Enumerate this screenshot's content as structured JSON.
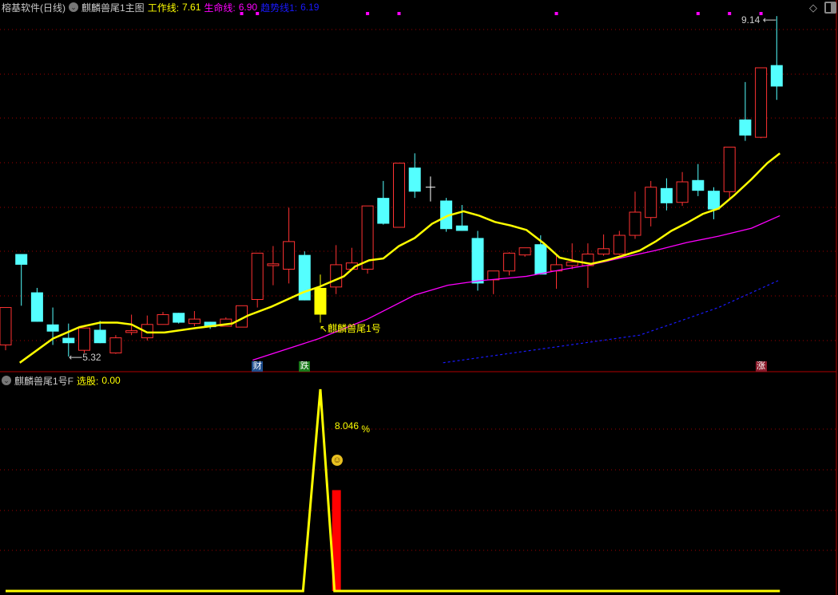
{
  "main_header": {
    "app_title": "榕基软件(日线)",
    "indicator_name": "麒麟兽尾1主图",
    "work_line_label": "工作线:",
    "work_line_value": "7.61",
    "life_line_label": "生命线:",
    "life_line_value": "6.90",
    "trend_line_label": "趋势线1:",
    "trend_line_value": "6.19"
  },
  "sub_header": {
    "indicator_name": "麒麟兽尾1号F",
    "select_label": "选股:",
    "select_value": "0.00"
  },
  "icons": {
    "collapse": "chevron-down-circle-icon",
    "diamond": "diamond-icon",
    "window": "window-toggle-icon"
  },
  "colors": {
    "up": "#ff3232",
    "down": "#54ffff",
    "signal": "#ffff00",
    "work_line": "#ffff00",
    "life_line": "#ff00ff",
    "trend_line": "#1a1aff",
    "grid": "#a00000"
  },
  "annotations": {
    "high_label": "9.14",
    "low_label": "5.32",
    "signal_label": "麒麟兽尾1号",
    "percent_value": "8.046",
    "percent_sign": "%",
    "markers": [
      {
        "text": "财",
        "index": 17,
        "bg": "#1f4f8f"
      },
      {
        "text": "跌",
        "index": 20,
        "bg": "#1a7a1a"
      },
      {
        "text": "涨",
        "index": 49,
        "bg": "#8a1a2a"
      }
    ],
    "top_dots": [
      16,
      17,
      24,
      26,
      36,
      45,
      47,
      49
    ]
  },
  "chart_data": {
    "type": "candlestick",
    "price_range": [
      5.32,
      9.14
    ],
    "signal_index": 21,
    "candles": [
      [
        5.45,
        5.87,
        5.87,
        5.39
      ],
      [
        6.47,
        6.35,
        6.47,
        5.89
      ],
      [
        6.04,
        5.71,
        6.09,
        5.71
      ],
      [
        5.68,
        5.6,
        5.87,
        5.45
      ],
      [
        5.53,
        5.47,
        5.69,
        5.32
      ],
      [
        5.39,
        5.64,
        5.64,
        5.36
      ],
      [
        5.62,
        5.47,
        5.72,
        5.47
      ],
      [
        5.36,
        5.53,
        5.56,
        5.35
      ],
      [
        5.59,
        5.61,
        5.79,
        5.56
      ],
      [
        5.53,
        5.68,
        5.78,
        5.5
      ],
      [
        5.68,
        5.79,
        5.82,
        5.68
      ],
      [
        5.81,
        5.7,
        5.81,
        5.69
      ],
      [
        5.69,
        5.74,
        5.83,
        5.66
      ],
      [
        5.71,
        5.65,
        5.71,
        5.63
      ],
      [
        5.66,
        5.74,
        5.76,
        5.66
      ],
      [
        5.65,
        5.89,
        5.89,
        5.65
      ],
      [
        5.96,
        6.48,
        6.48,
        5.87
      ],
      [
        6.34,
        6.36,
        6.56,
        6.12
      ],
      [
        6.3,
        6.61,
        6.99,
        6.14
      ],
      [
        6.46,
        5.95,
        6.5,
        5.95
      ],
      [
        6.09,
        5.79,
        6.24,
        5.7
      ],
      [
        6.1,
        6.35,
        6.57,
        6.02
      ],
      [
        6.3,
        6.37,
        6.54,
        6.3
      ],
      [
        6.3,
        7.01,
        7.01,
        6.25
      ],
      [
        7.1,
        6.81,
        7.29,
        6.8
      ],
      [
        6.77,
        7.49,
        7.49,
        6.77
      ],
      [
        7.44,
        7.17,
        7.6,
        7.1
      ],
      [
        7.22,
        7.22,
        7.34,
        7.06
      ],
      [
        7.07,
        6.75,
        7.1,
        6.72
      ],
      [
        6.79,
        6.73,
        7.02,
        6.73
      ],
      [
        6.65,
        6.14,
        6.73,
        6.06
      ],
      [
        6.18,
        6.28,
        6.28,
        6.02
      ],
      [
        6.28,
        6.48,
        6.49,
        6.23
      ],
      [
        6.46,
        6.54,
        6.54,
        6.44
      ],
      [
        6.58,
        6.24,
        6.68,
        6.24
      ],
      [
        6.28,
        6.35,
        6.45,
        6.08
      ],
      [
        6.34,
        6.38,
        6.59,
        6.3
      ],
      [
        6.34,
        6.47,
        6.59,
        6.09
      ],
      [
        6.47,
        6.53,
        6.69,
        6.45
      ],
      [
        6.47,
        6.68,
        6.73,
        6.46
      ],
      [
        6.68,
        6.94,
        7.17,
        6.64
      ],
      [
        6.88,
        7.22,
        7.29,
        6.78
      ],
      [
        7.21,
        7.04,
        7.32,
        6.96
      ],
      [
        7.05,
        7.28,
        7.39,
        7.01
      ],
      [
        7.3,
        7.18,
        7.48,
        7.12
      ],
      [
        7.18,
        6.97,
        7.22,
        6.86
      ],
      [
        7.17,
        7.67,
        7.67,
        7.07
      ],
      [
        7.98,
        7.8,
        8.4,
        7.74
      ],
      [
        7.78,
        8.56,
        8.56,
        7.77
      ],
      [
        8.59,
        8.35,
        9.14,
        8.2
      ]
    ],
    "candle_fields": [
      "open",
      "close",
      "high",
      "low"
    ],
    "work_line": [
      [
        1.9,
        5.25
      ],
      [
        4.0,
        5.52
      ],
      [
        5.7,
        5.65
      ],
      [
        7.0,
        5.7
      ],
      [
        8.1,
        5.7
      ],
      [
        9.0,
        5.68
      ],
      [
        10.0,
        5.59
      ],
      [
        11.1,
        5.59
      ],
      [
        13.1,
        5.64
      ],
      [
        15.4,
        5.69
      ],
      [
        16.4,
        5.78
      ],
      [
        17.9,
        5.88
      ],
      [
        19.9,
        6.04
      ],
      [
        20.9,
        6.1
      ],
      [
        22.5,
        6.22
      ],
      [
        23.2,
        6.33
      ],
      [
        24.1,
        6.4
      ],
      [
        25.0,
        6.42
      ],
      [
        26.0,
        6.56
      ],
      [
        27.0,
        6.65
      ],
      [
        28.1,
        6.81
      ],
      [
        29.1,
        6.9
      ],
      [
        30.1,
        6.95
      ],
      [
        31.1,
        6.9
      ],
      [
        32.1,
        6.83
      ],
      [
        33.1,
        6.79
      ],
      [
        34.1,
        6.74
      ],
      [
        35.2,
        6.59
      ],
      [
        36.2,
        6.43
      ],
      [
        37.2,
        6.39
      ],
      [
        38.2,
        6.36
      ],
      [
        39.2,
        6.4
      ],
      [
        40.2,
        6.45
      ],
      [
        41.3,
        6.51
      ],
      [
        42.3,
        6.61
      ],
      [
        43.3,
        6.73
      ],
      [
        44.3,
        6.82
      ],
      [
        45.3,
        6.92
      ],
      [
        46.3,
        6.98
      ],
      [
        47.3,
        7.13
      ],
      [
        48.4,
        7.31
      ],
      [
        49.4,
        7.49
      ],
      [
        50.2,
        7.6
      ]
    ],
    "life_line": [
      [
        16.7,
        5.28
      ],
      [
        20.9,
        5.52
      ],
      [
        24.0,
        5.74
      ],
      [
        27.0,
        6.01
      ],
      [
        29.1,
        6.12
      ],
      [
        31.1,
        6.17
      ],
      [
        34.1,
        6.22
      ],
      [
        36.2,
        6.29
      ],
      [
        38.2,
        6.35
      ],
      [
        40.2,
        6.43
      ],
      [
        42.3,
        6.51
      ],
      [
        44.3,
        6.6
      ],
      [
        46.3,
        6.67
      ],
      [
        48.4,
        6.76
      ],
      [
        50.2,
        6.9
      ]
    ],
    "trend_line": [
      [
        28.8,
        5.25
      ],
      [
        41.3,
        5.56
      ],
      [
        46.3,
        5.87
      ],
      [
        50.2,
        6.18
      ]
    ],
    "sub_line": [
      [
        1,
        0
      ],
      [
        19.9,
        0
      ],
      [
        21.0,
        1
      ],
      [
        21.9,
        0
      ],
      [
        50.2,
        0
      ]
    ],
    "sub_bar": {
      "index": 22,
      "value": 0.5
    }
  }
}
